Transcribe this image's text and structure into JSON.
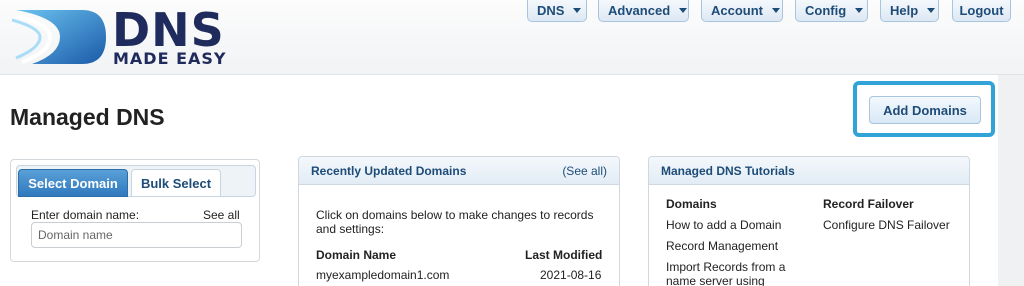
{
  "brand": {
    "name": "DNS",
    "tagline": "MADE EASY"
  },
  "nav": [
    {
      "label": "DNS",
      "dropdown": true
    },
    {
      "label": "Advanced",
      "dropdown": true
    },
    {
      "label": "Account",
      "dropdown": true
    },
    {
      "label": "Config",
      "dropdown": true
    },
    {
      "label": "Help",
      "dropdown": true
    },
    {
      "label": "Logout",
      "dropdown": false
    }
  ],
  "page": {
    "title": "Managed DNS",
    "add_button": "Add Domains"
  },
  "select_panel": {
    "tabs": [
      "Select Domain",
      "Bulk Select"
    ],
    "active_tab": "Select Domain",
    "label": "Enter domain name:",
    "see_all": "See all",
    "input_placeholder": "Domain name",
    "input_value": ""
  },
  "recent": {
    "title": "Recently Updated Domains",
    "see_all": "(See all)",
    "intro": "Click on domains below to make changes to records and settings:",
    "columns": [
      "Domain Name",
      "Last Modified"
    ],
    "rows": [
      {
        "domain": "myexampledomain1.com",
        "modified": "2021-08-16"
      }
    ]
  },
  "tutorials": {
    "title": "Managed DNS Tutorials",
    "sections": [
      {
        "heading": "Domains",
        "items": [
          "How to add a Domain",
          "Record Management",
          "Import Records from a name server using"
        ]
      },
      {
        "heading": "Record Failover",
        "items": [
          "Configure DNS Failover"
        ]
      }
    ]
  },
  "colors": {
    "brand": "#1f2b5c",
    "accent": "#1e4c78",
    "tab_active": "#2f79bd",
    "highlight": "#31a3d6"
  }
}
